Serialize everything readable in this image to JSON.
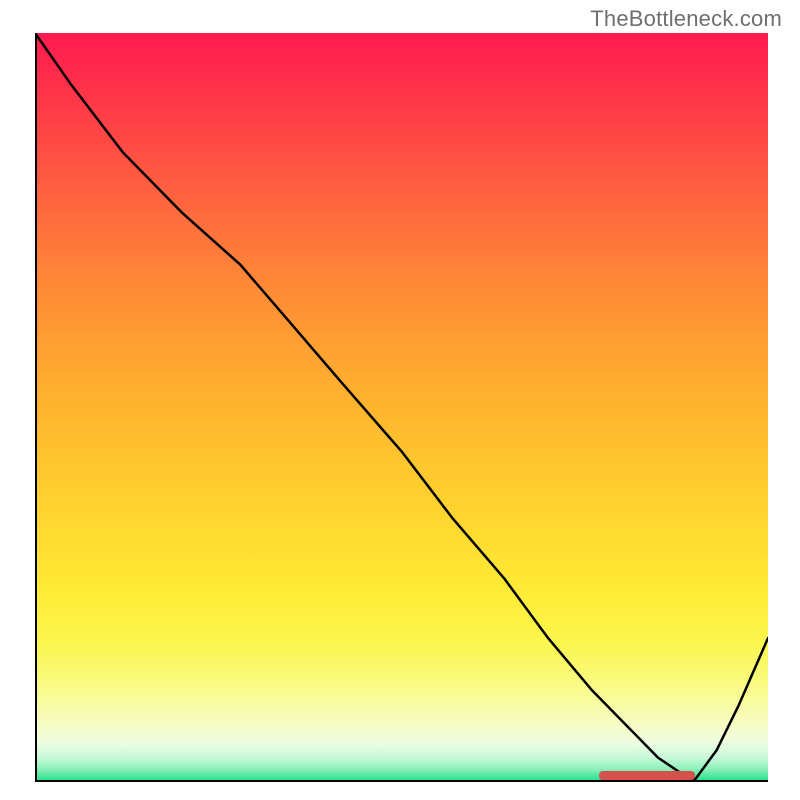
{
  "watermark": "TheBottleneck.com",
  "chart_data": {
    "type": "line",
    "title": "",
    "xlabel": "",
    "ylabel": "",
    "xlim": [
      0,
      100
    ],
    "ylim": [
      0,
      100
    ],
    "x": [
      0,
      5,
      12,
      20,
      28,
      35,
      42,
      50,
      57,
      64,
      70,
      76,
      81,
      85,
      88,
      90,
      93,
      96,
      100
    ],
    "values": [
      100,
      93,
      84,
      76,
      69,
      61,
      53,
      44,
      35,
      27,
      19,
      12,
      7,
      3,
      1,
      0,
      4,
      10,
      19
    ],
    "marker": {
      "x_start": 77,
      "x_end": 90,
      "y": 0.4,
      "color": "#d4524b"
    },
    "gradient": {
      "top": "#ff1a4f",
      "mid": "#ffdd30",
      "bottom": "#2ce18f"
    }
  }
}
